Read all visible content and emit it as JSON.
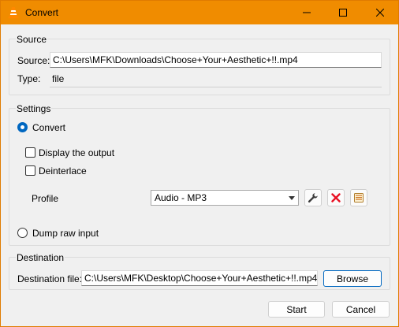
{
  "window": {
    "title": "Convert",
    "title_bar_color": "#f08c00",
    "icon": "vlc-cone-icon"
  },
  "source": {
    "group_label": "Source",
    "source_label": "Source:",
    "source_value": "C:\\Users\\MFK\\Downloads\\Choose+Your+Aesthetic+!!.mp4",
    "type_label": "Type:",
    "type_value": "file"
  },
  "settings": {
    "group_label": "Settings",
    "convert_label": "Convert",
    "convert_selected": true,
    "display_output_label": "Display the output",
    "display_output_checked": false,
    "deinterlace_label": "Deinterlace",
    "deinterlace_checked": false,
    "profile_label": "Profile",
    "profile_value": "Audio - MP3",
    "profile_edit_icon": "wrench-icon",
    "profile_delete_icon": "red-x-icon",
    "profile_new_icon": "new-profile-icon",
    "dump_raw_label": "Dump raw input",
    "dump_raw_selected": false
  },
  "destination": {
    "group_label": "Destination",
    "file_label": "Destination file:",
    "file_value": "C:\\Users\\MFK\\Desktop\\Choose+Your+Aesthetic+!!.mp4",
    "browse_label": "Browse"
  },
  "footer": {
    "start_label": "Start",
    "cancel_label": "Cancel"
  },
  "colors": {
    "accent": "#0067c0",
    "delete_red": "#e81123"
  }
}
